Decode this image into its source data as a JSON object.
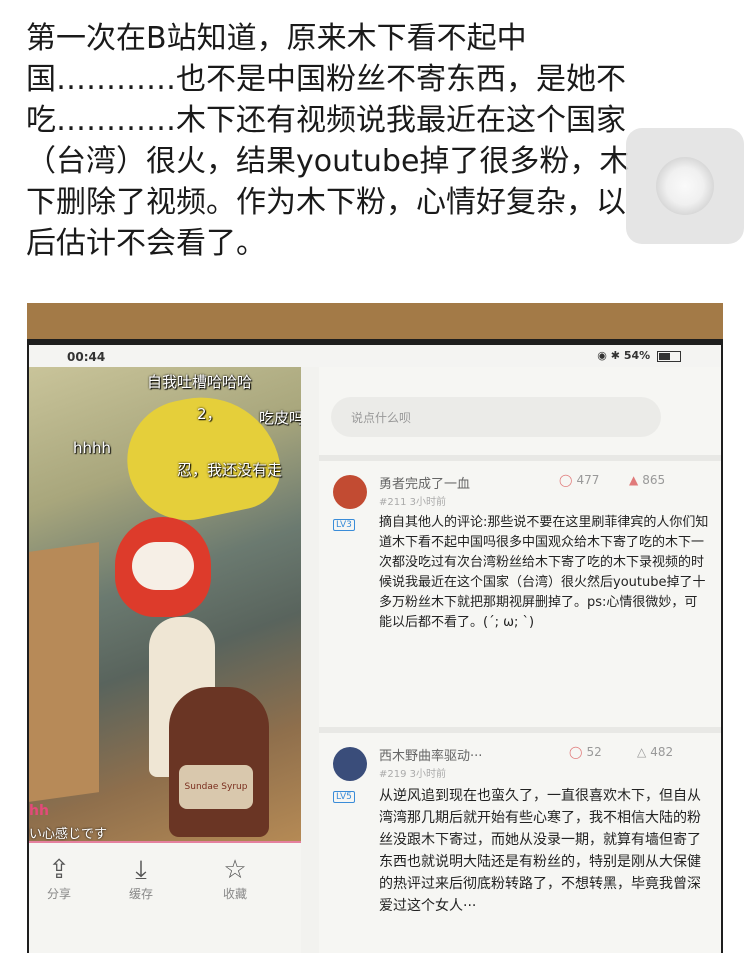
{
  "post": {
    "lines": [
      "第一次在B站知道，原来木下看不起中",
      "国…………也不是中国粉丝不寄东西，是她不",
      "吃…………木下还有视频说我最近在这个国家",
      "（台湾）很火，结果youtube掉了很多粉，木",
      "下删除了视频。作为木下粉，心情好复杂，以",
      "后估计不会看了。"
    ]
  },
  "status_bar": {
    "time": "00:44",
    "battery": "54%"
  },
  "video": {
    "danmaku": [
      "自我吐槽哈哈哈",
      "2，",
      "吃皮吗",
      "hhhh",
      "忍，我还没有走"
    ],
    "pink_text": "hh",
    "caption": "い心感じです",
    "bottle_label": "Sundae Syrup"
  },
  "actions": [
    {
      "icon": "share-icon",
      "label": "分享"
    },
    {
      "icon": "download-icon",
      "label": "缓存"
    },
    {
      "icon": "star-icon",
      "label": "收藏"
    }
  ],
  "comment_input": {
    "placeholder": "说点什么呗"
  },
  "comments": [
    {
      "user": "勇者完成了一血",
      "floor": "#211",
      "time": "3小时前",
      "level": "LV3",
      "replies": "477",
      "likes": "865",
      "text": "摘自其他人的评论:那些说不要在这里刷菲律宾的人你们知道木下看不起中国吗很多中国观众给木下寄了吃的木下一次都没吃过有次台湾粉丝给木下寄了吃的木下录视频的时候说我最近在这个国家（台湾）很火然后youtube掉了十多万粉丝木下就把那期视屏删掉了。ps:心情很微妙，可能以后都不看了。(´; ω; `)"
    },
    {
      "user": "西木野曲率驱动···",
      "floor": "#219",
      "time": "3小时前",
      "level": "LV5",
      "replies": "52",
      "likes": "482",
      "text": "从逆风追到现在也蛮久了，一直很喜欢木下，但自从湾湾那几期后就开始有些心寒了，我不相信大陆的粉丝没跟木下寄过，而她从没录一期，就算有墙但寄了东西也就说明大陆还是有粉丝的，特别是刚从大保健的热评过来后彻底粉转路了，不想转黑，毕竟我曾深爱过这个女人···"
    }
  ]
}
